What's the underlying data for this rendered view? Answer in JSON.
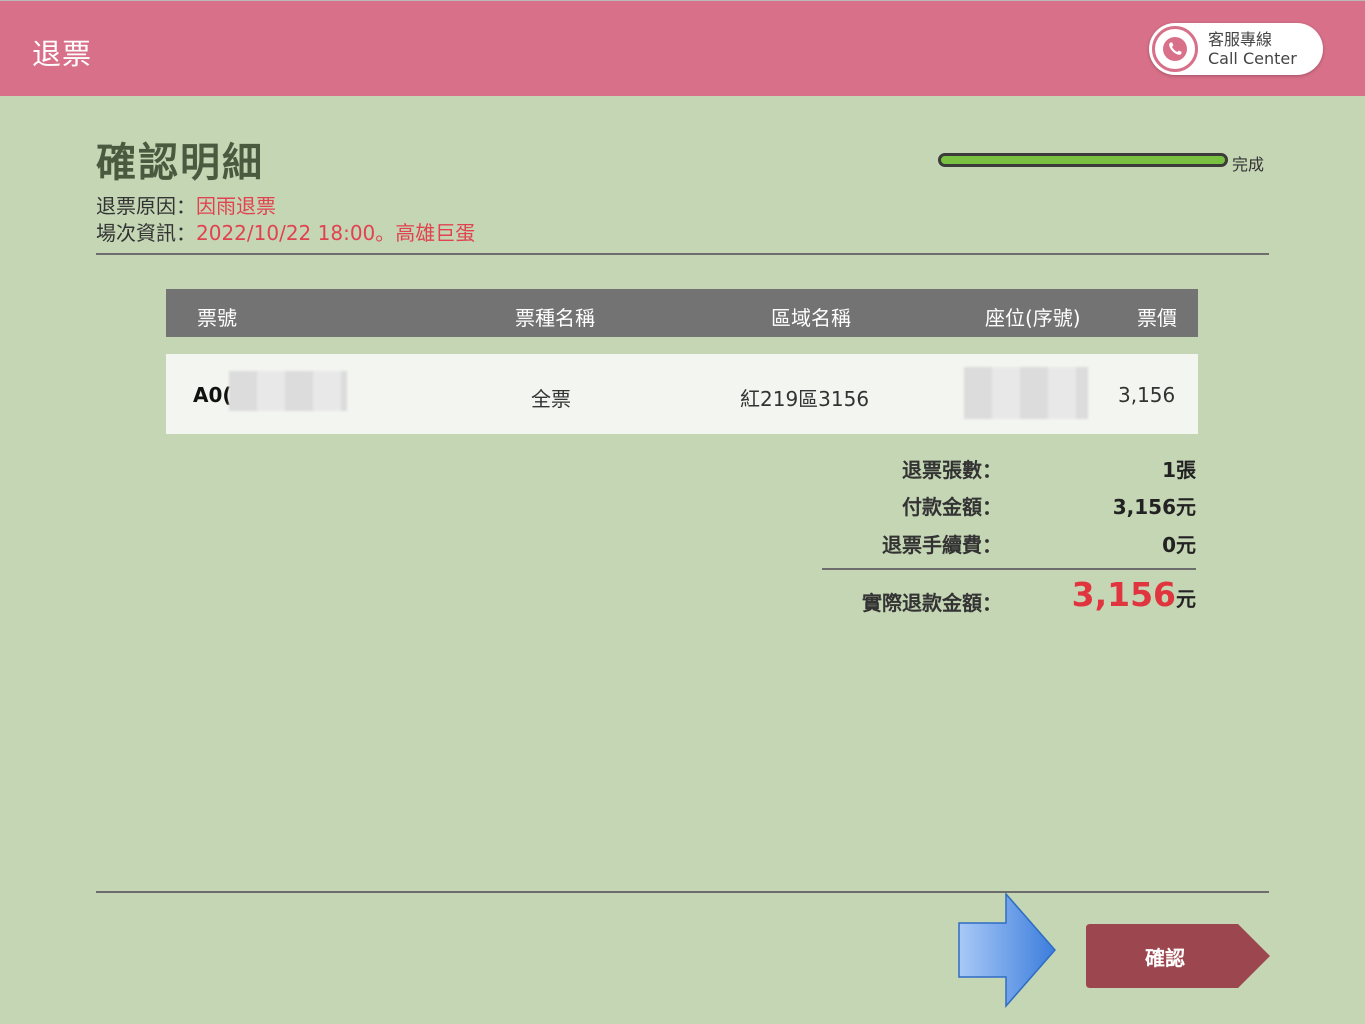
{
  "header": {
    "title": "退票",
    "call_center": {
      "label_zh": "客服專線",
      "label_en": "Call Center"
    }
  },
  "page": {
    "title": "確認明細",
    "reason_label": "退票原因：",
    "reason_value": "因雨退票",
    "session_label": "場次資訊：",
    "session_value": "2022/10/22 18:00。高雄巨蛋"
  },
  "progress": {
    "label": "完成",
    "value": 1.0
  },
  "table": {
    "columns": [
      "票號",
      "票種名稱",
      "區域名稱",
      "座位(序號)",
      "票價"
    ],
    "rows": [
      {
        "ticket_no": "A0(",
        "ticket_type": "全票",
        "area": "紅219區3156",
        "seat": "",
        "price": "3,156"
      }
    ]
  },
  "summary": {
    "count_label": "退票張數：",
    "count_value": "1張",
    "paid_label": "付款金額：",
    "paid_value": "3,156元",
    "fee_label": "退票手續費：",
    "fee_value": "0元",
    "refund_label": "實際退款金額：",
    "refund_amount": "3,156",
    "refund_unit": "元"
  },
  "actions": {
    "confirm_label": "確認"
  },
  "colors": {
    "header": "#d87089",
    "background": "#c5d6b5",
    "accent_red": "#e0434f",
    "confirm_button": "#9c474f",
    "progress_fill": "#7ac142"
  }
}
